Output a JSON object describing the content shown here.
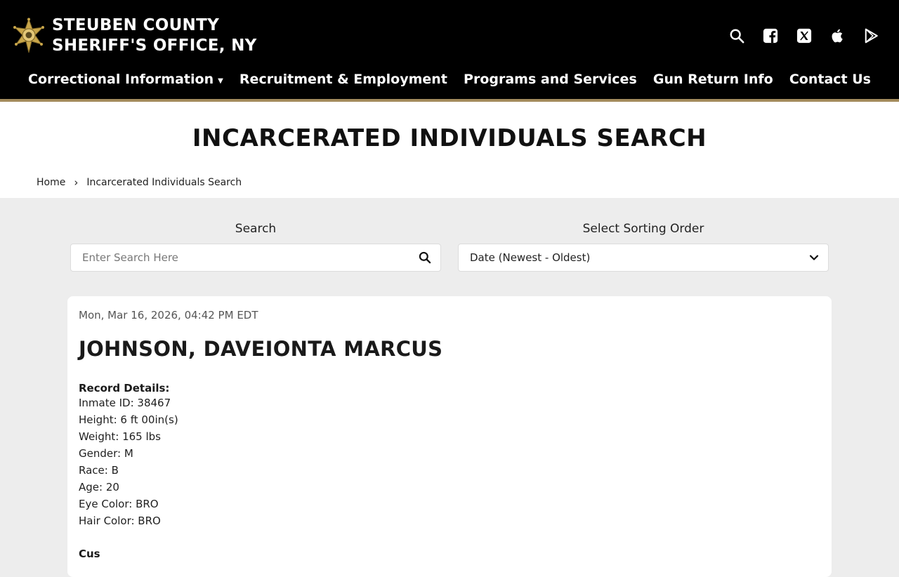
{
  "header": {
    "title_line1": "STEUBEN COUNTY",
    "title_line2": "SHERIFF'S OFFICE, NY",
    "icons": [
      "search-icon",
      "facebook-icon",
      "x-twitter-icon",
      "apple-icon",
      "google-play-icon"
    ]
  },
  "nav": {
    "items": [
      {
        "label": "Correctional Information",
        "dropdown": true
      },
      {
        "label": "Recruitment & Employment"
      },
      {
        "label": "Programs and Services"
      },
      {
        "label": "Gun Return Info"
      },
      {
        "label": "Contact Us"
      }
    ]
  },
  "page": {
    "title": "INCARCERATED INDIVIDUALS SEARCH",
    "breadcrumb": [
      "Home",
      "Incarcerated Individuals Search"
    ]
  },
  "search": {
    "label": "Search",
    "placeholder": "Enter Search Here",
    "value": ""
  },
  "sort": {
    "label": "Select Sorting Order",
    "selected": "Date (Newest - Oldest)"
  },
  "record": {
    "date": "Mon, Mar 16, 2026, 04:42 PM EDT",
    "name": "JOHNSON, DAVEIONTA MARCUS",
    "details_heading": "Record Details:",
    "details": [
      "Inmate ID: 38467",
      "Height: 6 ft 00in(s)",
      "Weight: 165 lbs",
      "Gender: M",
      "Race: B",
      "Age: 20",
      "Eye Color: BRO",
      "Hair Color: BRO"
    ],
    "next_heading": "Cus"
  },
  "colors": {
    "header_bg": "#000000",
    "accent_gold": "#a38b5c",
    "page_bg": "#ededed"
  }
}
